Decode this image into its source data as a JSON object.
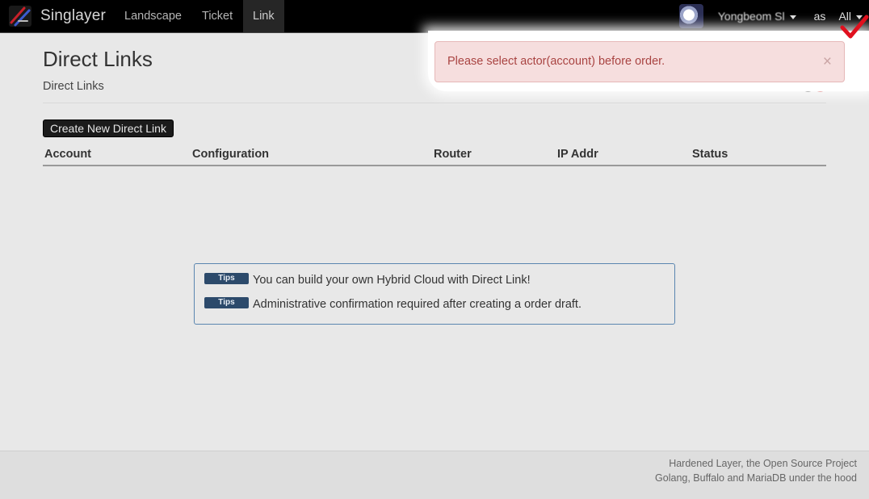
{
  "app": {
    "brand": "Singlayer"
  },
  "nav": {
    "items": [
      {
        "label": "Landscape",
        "active": false
      },
      {
        "label": "Ticket",
        "active": false
      },
      {
        "label": "Link",
        "active": true
      }
    ]
  },
  "user": {
    "name": "Yongbeom Sl",
    "as_label": "as",
    "actor": "All"
  },
  "alert": {
    "message": "Please select actor(account) before order.",
    "close": "×"
  },
  "page": {
    "title": "Direct Links",
    "subtitle": "Direct Links",
    "help_glyph": "?",
    "alert_glyph": "!",
    "create_button": "Create New Direct Link"
  },
  "table": {
    "columns": [
      "Account",
      "Configuration",
      "Router",
      "IP Addr",
      "Status"
    ],
    "rows": []
  },
  "tips": [
    {
      "badge": "Tips",
      "text": "You can build your own Hybrid Cloud with Direct Link!"
    },
    {
      "badge": "Tips",
      "text": "Administrative confirmation required after creating a order draft."
    }
  ],
  "footer": {
    "line1": "Hardened Layer, the Open Source Project",
    "line2": "Golang, Buffalo and MariaDB under the hood"
  },
  "colors": {
    "navbar": "#000000",
    "alert_bg": "#f6dede",
    "alert_text": "#a94442",
    "tips_border": "#5a86b0",
    "tips_badge": "#2c4a6b",
    "checkmark": "#e0101e"
  }
}
